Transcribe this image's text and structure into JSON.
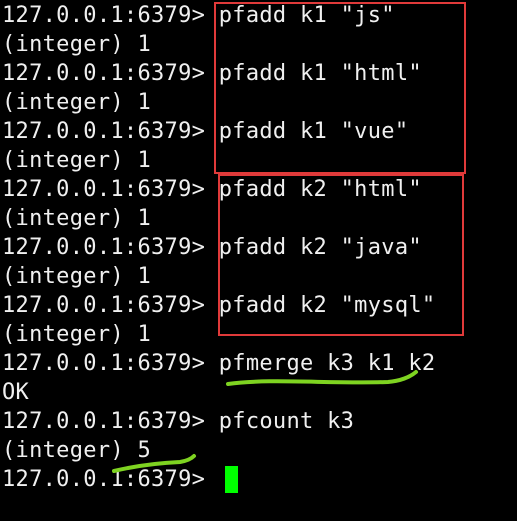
{
  "terminal": {
    "prompt": "127.0.0.1:6379> ",
    "lines": [
      {
        "prompt": "127.0.0.1:6379> ",
        "cmd": "pfadd k1 \"js\""
      },
      {
        "output": "(integer) 1"
      },
      {
        "prompt": "127.0.0.1:6379> ",
        "cmd": "pfadd k1 \"html\""
      },
      {
        "output": "(integer) 1"
      },
      {
        "prompt": "127.0.0.1:6379> ",
        "cmd": "pfadd k1 \"vue\""
      },
      {
        "output": "(integer) 1"
      },
      {
        "prompt": "127.0.0.1:6379> ",
        "cmd": "pfadd k2 \"html\""
      },
      {
        "output": "(integer) 1"
      },
      {
        "prompt": "127.0.0.1:6379> ",
        "cmd": "pfadd k2 \"java\""
      },
      {
        "output": "(integer) 1"
      },
      {
        "prompt": "127.0.0.1:6379> ",
        "cmd": "pfadd k2 \"mysql\""
      },
      {
        "output": "(integer) 1"
      },
      {
        "prompt": "127.0.0.1:6379> ",
        "cmd": "pfmerge k3 k1 k2"
      },
      {
        "output": "OK"
      },
      {
        "prompt": "127.0.0.1:6379> ",
        "cmd": "pfcount k3"
      },
      {
        "output": "(integer) 5"
      },
      {
        "prompt": "127.0.0.1:6379> ",
        "cmd": ""
      }
    ]
  },
  "colors": {
    "background": "#000000",
    "text": "#f0f0f0",
    "cursor": "#00ff00",
    "highlight_box": "#e03a3a",
    "underline": "#7ed321"
  }
}
